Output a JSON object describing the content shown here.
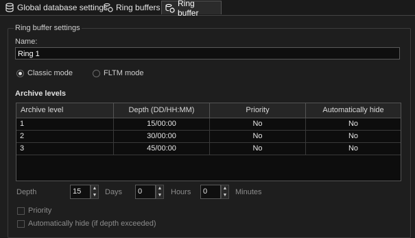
{
  "tabs": [
    {
      "label": "Global database settings",
      "icon": "database-icon"
    },
    {
      "label": "Ring buffers",
      "icon": "ring-buffer-icon"
    },
    {
      "label": "Ring buffer",
      "icon": "ring-buffer-icon"
    }
  ],
  "group_title": "Ring buffer settings",
  "name_label": "Name:",
  "name_value": "Ring 1",
  "mode": {
    "classic_label": "Classic mode",
    "fltm_label": "FLTM mode",
    "selected": "classic"
  },
  "archive_title": "Archive levels",
  "table": {
    "headers": [
      "Archive level",
      "Depth (DD/HH:MM)",
      "Priority",
      "Automatically hide"
    ],
    "rows": [
      [
        "1",
        "15/00:00",
        "No",
        "No"
      ],
      [
        "2",
        "30/00:00",
        "No",
        "No"
      ],
      [
        "3",
        "45/00:00",
        "No",
        "No"
      ]
    ]
  },
  "depth": {
    "label": "Depth",
    "days_value": "15",
    "days_label": "Days",
    "hours_value": "0",
    "hours_label": "Hours",
    "minutes_value": "0",
    "minutes_label": "Minutes"
  },
  "priority_label": "Priority",
  "autohide_label": "Automatically hide (if depth exceeded)"
}
